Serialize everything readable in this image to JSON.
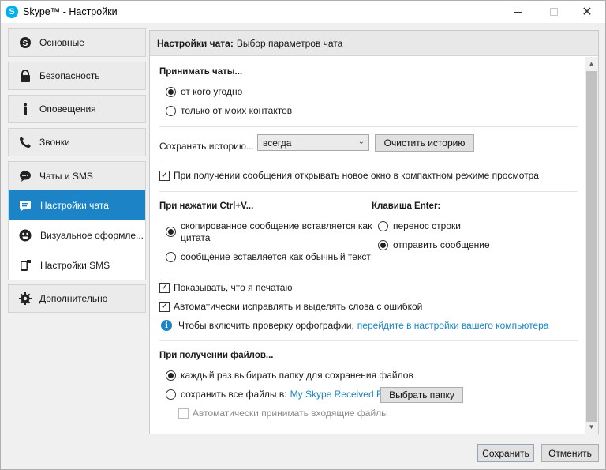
{
  "window": {
    "title": "Skype™ - Настройки",
    "app_icon": "S"
  },
  "sidebar": {
    "items": [
      {
        "label": "Основные",
        "icon": "skype-icon"
      },
      {
        "label": "Безопасность",
        "icon": "lock-icon"
      },
      {
        "label": "Оповещения",
        "icon": "info-icon"
      },
      {
        "label": "Звонки",
        "icon": "phone-icon"
      }
    ],
    "group": {
      "label": "Чаты и SMS",
      "icon": "chat-icon",
      "sub_items": [
        {
          "label": "Настройки чата",
          "icon": "chat-bubble-icon",
          "active": true
        },
        {
          "label": "Визуальное оформле...",
          "icon": "smiley-icon"
        },
        {
          "label": "Настройки SMS",
          "icon": "sms-phone-icon"
        }
      ]
    },
    "extra": {
      "label": "Дополнительно",
      "icon": "gear-icon"
    }
  },
  "header": {
    "bold": "Настройки чата:",
    "text": "Выбор параметров чата"
  },
  "accept": {
    "title": "Принимать чаты...",
    "options": [
      "от кого угодно",
      "только от моих контактов"
    ],
    "selected": 0
  },
  "history": {
    "label": "Сохранять историю...",
    "value": "всегда",
    "clear_button": "Очистить историю"
  },
  "compact": {
    "label": "При получении сообщения открывать новое окно в компактном режиме просмотра",
    "checked": true
  },
  "paste": {
    "title": "При нажатии Ctrl+V...",
    "option1_line1": "скопированное сообщение вставляется как",
    "option1_line2": "цитата",
    "option2": "сообщение вставляется как обычный текст",
    "selected": 0
  },
  "enter_key": {
    "title": "Клавиша Enter:",
    "options": [
      "перенос строки",
      "отправить сообщение"
    ],
    "selected": 1
  },
  "typing": {
    "label": "Показывать, что я печатаю",
    "checked": true
  },
  "spell": {
    "label": "Автоматически исправлять и выделять слова с ошибкой",
    "checked": true
  },
  "spell_info": {
    "text": "Чтобы включить проверку орфографии,",
    "link": "перейдите в настройки вашего компьютера"
  },
  "files": {
    "title": "При получении файлов...",
    "option1": "каждый раз выбирать папку для сохранения файлов",
    "option2": "сохранить все файлы в:",
    "folder_link": "My Skype Received Files",
    "choose_button": "Выбрать папку",
    "auto_accept": "Автоматически принимать входящие файлы",
    "selected": 0
  },
  "footer": {
    "save": "Сохранить",
    "cancel": "Отменить"
  },
  "colors": {
    "accent": "#1c84c6",
    "skype_blue": "#00aff0"
  }
}
